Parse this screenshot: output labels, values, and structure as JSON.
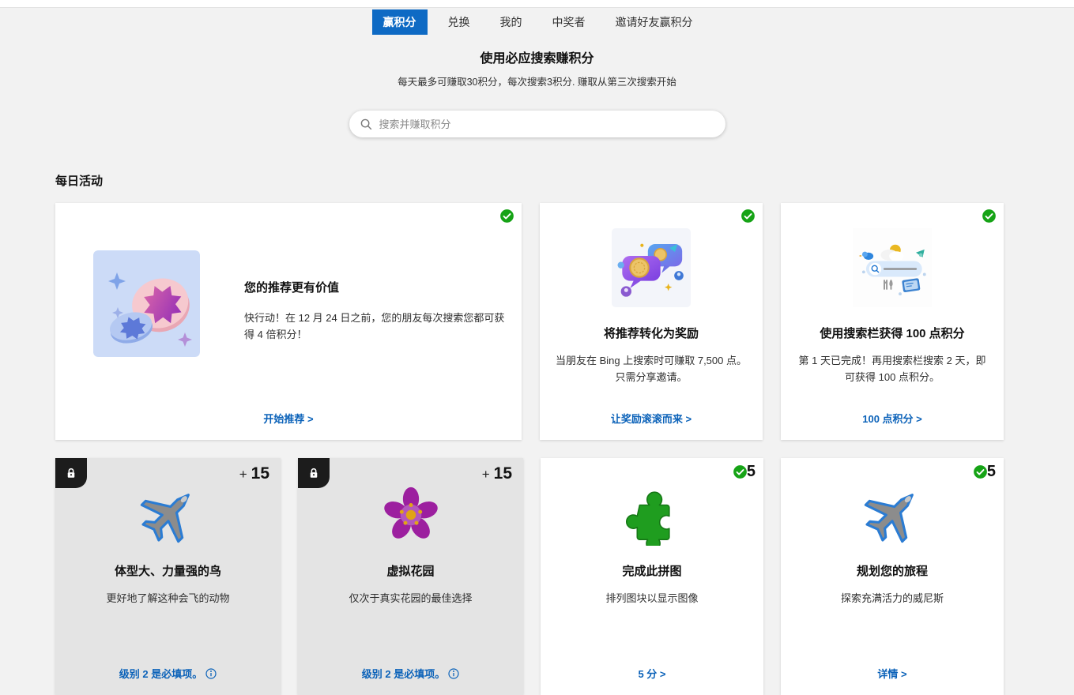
{
  "nav": {
    "tabs": [
      {
        "label": "赢积分",
        "active": true
      },
      {
        "label": "兑换",
        "active": false
      },
      {
        "label": "我的",
        "active": false
      },
      {
        "label": "中奖者",
        "active": false
      },
      {
        "label": "邀请好友赢积分",
        "active": false
      }
    ]
  },
  "header": {
    "title": "使用必应搜索赚积分",
    "subtitle": "每天最多可赚取30积分，每次搜索3积分. 赚取从第三次搜索开始"
  },
  "search": {
    "placeholder": "搜索并赚取积分"
  },
  "sections": {
    "daily": "每日活动"
  },
  "cards": {
    "featured": {
      "title": "您的推荐更有价值",
      "body": "快行动！在 12 月 24 日之前，您的朋友每次搜索您都可获得 4 倍积分！",
      "link": "开始推荐 >",
      "status": "completed"
    },
    "referral": {
      "title": "将推荐转化为奖励",
      "body": "当朋友在 Bing 上搜索时可赚取 7,500 点。只需分享邀请。",
      "link": "让奖励滚滚而来 >",
      "status": "completed"
    },
    "searchbar": {
      "title": "使用搜索栏获得 100 点积分",
      "body": "第 1 天已完成！再用搜索栏搜索 2 天，即可获得 100 点积分。",
      "link": "100 点积分 >",
      "status": "completed"
    },
    "bird": {
      "points_plus": "+",
      "points": "15",
      "title": "体型大、力量强的鸟",
      "body": "更好地了解这种会飞的动物",
      "footer": "级别 2 是必填项。",
      "status": "locked"
    },
    "garden": {
      "points_plus": "+",
      "points": "15",
      "title": "虚拟花园",
      "body": "仅次于真实花园的最佳选择",
      "footer": "级别 2 是必填项。",
      "status": "locked"
    },
    "puzzle": {
      "points": "5",
      "title": "完成此拼图",
      "body": "排列图块以显示图像",
      "link": "5 分 >",
      "status": "completed"
    },
    "trip": {
      "points": "5",
      "title": "规划您的旅程",
      "body": "探索充满活力的威尼斯",
      "link": "详情 >",
      "status": "completed"
    }
  },
  "colors": {
    "accent": "#0e6ac4",
    "link": "#0b62b9",
    "success": "#16a316",
    "locked_bg": "#e4e4e4"
  }
}
